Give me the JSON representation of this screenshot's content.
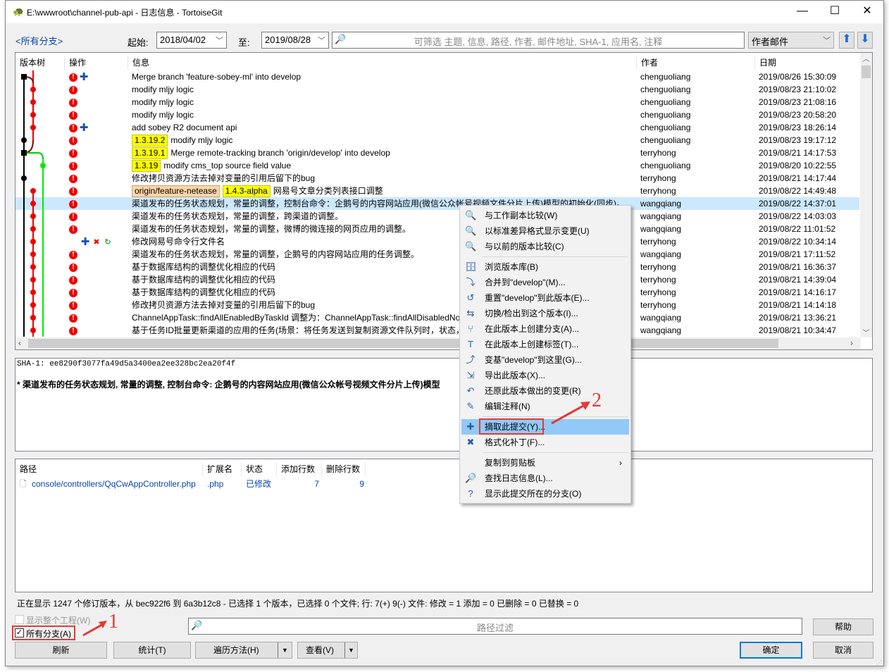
{
  "window": {
    "title": "E:\\wwwroot\\channel-pub-api - 日志信息 - TortoiseGit",
    "minimize": "—",
    "maximize": "☐",
    "close": "✕"
  },
  "toolbar": {
    "branch_link": "<所有分支>",
    "from_label": "起始:",
    "from_date": "2018/04/02",
    "to_label": "至:",
    "to_date": "2019/08/28",
    "search_placeholder": "可筛选 主题, 信息, 路径, 作者, 邮件地址, SHA-1, 应用名, 注释",
    "filter_field": "作者邮件"
  },
  "log": {
    "columns": [
      "版本树",
      "操作",
      "信息",
      "作者",
      "日期"
    ],
    "rows": [
      {
        "node": "black-square",
        "actions": [
          "mod",
          "add"
        ],
        "refs": [],
        "message": "Merge branch 'feature-sobey-ml' into develop",
        "author": "chenguoliang",
        "date": "2019/08/26 15:30:09"
      },
      {
        "node": "red",
        "actions": [
          "mod"
        ],
        "refs": [],
        "message": "modify mljy logic",
        "author": "chenguoliang",
        "date": "2019/08/23 21:10:02"
      },
      {
        "node": "red",
        "actions": [
          "mod"
        ],
        "refs": [],
        "message": "modify mljy logic",
        "author": "chenguoliang",
        "date": "2019/08/23 21:08:16"
      },
      {
        "node": "red",
        "actions": [
          "mod"
        ],
        "refs": [],
        "message": "modify mljy logic",
        "author": "chenguoliang",
        "date": "2019/08/23 20:58:20"
      },
      {
        "node": "red",
        "actions": [
          "mod",
          "add"
        ],
        "refs": [],
        "message": "add sobey R2 document api",
        "author": "chenguoliang",
        "date": "2019/08/23 18:26:14"
      },
      {
        "node": "black",
        "actions": [
          "mod"
        ],
        "refs": [
          {
            "text": "1.3.19.2",
            "kind": "tag"
          }
        ],
        "message": "modify mljy logic",
        "author": "chenguoliang",
        "date": "2019/08/23 19:17:12"
      },
      {
        "node": "black-square",
        "actions": [
          "mod"
        ],
        "refs": [
          {
            "text": "1.3.19.1",
            "kind": "tag"
          }
        ],
        "message": "Merge remote-tracking branch 'origin/develop' into develop",
        "author": "terryhong",
        "date": "2019/08/21 14:17:53"
      },
      {
        "node": "green",
        "actions": [
          "mod"
        ],
        "refs": [
          {
            "text": "1.3.19",
            "kind": "tag"
          }
        ],
        "message": "modify cms_top source field value",
        "author": "chenguoliang",
        "date": "2019/08/20 10:22:55"
      },
      {
        "node": "black",
        "actions": [
          "mod"
        ],
        "refs": [],
        "message": "修改拷贝资源方法去掉对变量的引用后留下的bug",
        "author": "terryhong",
        "date": "2019/08/21 14:17:44"
      },
      {
        "node": "red",
        "actions": [
          "mod"
        ],
        "refs": [
          {
            "text": "origin/feature-netease",
            "kind": "ref"
          },
          {
            "text": "1.4.3-alpha",
            "kind": "tag"
          }
        ],
        "message": "网易号文章分类列表接口调整",
        "author": "terryhong",
        "date": "2019/08/22 14:49:48"
      },
      {
        "node": "red",
        "actions": [
          "mod"
        ],
        "refs": [],
        "selected": true,
        "message": "渠道发布的任务状态规划，常量的调整，控制台命令：企鹅号的内容网站应用(微信公众帐号视频文件分片上传)模型的初始化(同步)。",
        "author": "wangqiang",
        "date": "2019/08/22 14:37:01"
      },
      {
        "node": "red",
        "actions": [
          "mod"
        ],
        "refs": [],
        "message": "渠道发布的任务状态规划，常量的调整，跨渠道的调整。",
        "author": "wangqiang",
        "date": "2019/08/22 14:03:03"
      },
      {
        "node": "red",
        "actions": [
          "mod"
        ],
        "refs": [],
        "message": "渠道发布的任务状态规划，常量的调整，微博的微连接的网页应用的调整。",
        "author": "wangqiang",
        "date": "2019/08/22 11:01:52"
      },
      {
        "node": "red",
        "actions": [
          "add",
          "del",
          "ren"
        ],
        "refs": [],
        "message": "修改网易号命令行文件名",
        "author": "terryhong",
        "date": "2019/08/22 10:34:14"
      },
      {
        "node": "red",
        "actions": [
          "mod"
        ],
        "refs": [],
        "message": "渠道发布的任务状态规划，常量的调整，企鹅号的内容网站应用的任务调整。",
        "author": "wangqiang",
        "date": "2019/08/21 17:11:52"
      },
      {
        "node": "red",
        "actions": [
          "mod"
        ],
        "refs": [],
        "message": "基于数据库结构的调整优化相应的代码",
        "author": "terryhong",
        "date": "2019/08/21 16:36:37"
      },
      {
        "node": "red",
        "actions": [
          "mod"
        ],
        "refs": [],
        "message": "基于数据库结构的调整优化相应的代码",
        "author": "terryhong",
        "date": "2019/08/21 14:39:04"
      },
      {
        "node": "red",
        "actions": [
          "mod"
        ],
        "refs": [],
        "message": "基于数据库结构的调整优化相应的代码",
        "author": "terryhong",
        "date": "2019/08/21 14:16:17"
      },
      {
        "node": "red",
        "actions": [
          "mod"
        ],
        "refs": [],
        "message": "修改拷贝资源方法去掉对变量的引用后留下的bug",
        "author": "terryhong",
        "date": "2019/08/21 14:14:18"
      },
      {
        "node": "red",
        "actions": [
          "mod"
        ],
        "refs": [],
        "message": "ChannelAppTask::findAllEnabledByTaskId 调整为：ChannelAppTask::findAllDisabledNot",
        "author": "wangqiang",
        "date": "2019/08/21 13:36:21"
      },
      {
        "node": "red",
        "actions": [
          "mod"
        ],
        "refs": [],
        "message": "基于任务ID批量更新渠道的应用的任务(场景：将任务发送到复制资源文件队列时，状态，",
        "author": "wangqiang",
        "date": "2019/08/21 10:34:47"
      }
    ]
  },
  "detail": {
    "sha": "SHA-1: ee8290f3077fa49d5a3400ea2ee328bc2ea20f4f",
    "message": "* 渠道发布的任务状态规划, 常量的调整, 控制台命令: 企鹅号的内容网站应用(微信公众帐号视频文件分片上传)模型"
  },
  "files": {
    "columns": [
      "路径",
      "扩展名",
      "状态",
      "添加行数",
      "删除行数"
    ],
    "rows": [
      {
        "path": "console/controllers/QqCwAppController.php",
        "ext": ".php",
        "status": "已修改",
        "added": "7",
        "deleted": "9"
      }
    ]
  },
  "status_line": "正在显示 1247 个修订版本，从 bec922f6 到 6a3b12c8 - 已选择 1 个版本，已选择 0 个文件; 行: 7(+) 9(-) 文件: 修改 = 1 添加 = 0 已删除 = 0 已替换 = 0",
  "options": {
    "show_whole_project": "显示整个工程(W)",
    "show_whole_project_checked": false,
    "all_branches": "所有分支(A)",
    "all_branches_checked": true
  },
  "path_filter_placeholder": "路径过滤",
  "buttons": {
    "refresh": "刷新",
    "stats": "统计(T)",
    "walk": "遍历方法(H)",
    "view": "查看(V)",
    "help": "帮助",
    "ok": "确定",
    "cancel": "取消"
  },
  "context_menu": [
    {
      "icon": "🔍",
      "label": "与工作副本比较(W)"
    },
    {
      "icon": "🔍",
      "label": "以标准差异格式显示变更(U)"
    },
    {
      "icon": "🔍",
      "label": "与以前的版本比较(C)"
    },
    {
      "sep": true
    },
    {
      "icon": "🗄",
      "label": "浏览版本库(B)"
    },
    {
      "icon": "⤵",
      "label": "合并到\"develop\"(M)..."
    },
    {
      "icon": "↺",
      "label": "重置\"develop\"到此版本(E)..."
    },
    {
      "icon": "⇆",
      "label": "切换/检出到这个版本(I)..."
    },
    {
      "icon": "⑂",
      "label": "在此版本上创建分支(A)..."
    },
    {
      "icon": "T",
      "label": "在此版本上创建标签(T)..."
    },
    {
      "icon": "⤴",
      "label": "变基\"develop\"到这里(G)..."
    },
    {
      "icon": "⇲",
      "label": "导出此版本(X)..."
    },
    {
      "icon": "↶",
      "label": "还原此版本做出的变更(R)"
    },
    {
      "icon": "✎",
      "label": "编辑注释(N)"
    },
    {
      "sep": true
    },
    {
      "icon": "✚",
      "label": "摘取此提交(Y)...",
      "highlight": true
    },
    {
      "icon": "✖",
      "label": "格式化补丁(F)..."
    },
    {
      "sep": true
    },
    {
      "icon": "",
      "label": "复制到剪贴板",
      "submenu": true
    },
    {
      "icon": "🔎",
      "label": "查找日志信息(L)..."
    },
    {
      "icon": "?",
      "label": "显示此提交所在的分支(O)"
    }
  ],
  "annotations": {
    "step1": "1",
    "step2": "2"
  },
  "colors": {
    "selection": "#cce8ff",
    "menu_highlight": "#91c9f7",
    "annotation": "#e53935",
    "tag": "#ffff00",
    "ref": "#fcd5a8"
  }
}
